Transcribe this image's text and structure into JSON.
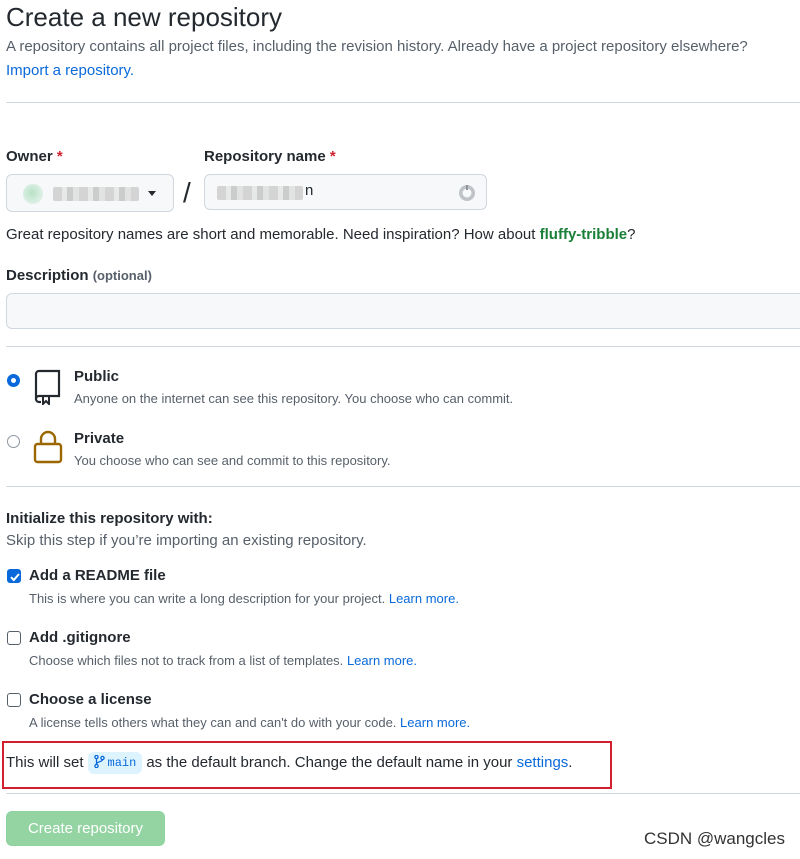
{
  "header": {
    "title": "Create a new repository",
    "subtitle": "A repository contains all project files, including the revision history. Already have a project repository elsewhere?",
    "import_link": "Import a repository."
  },
  "owner": {
    "label": "Owner",
    "required_mark": "*",
    "avatar_icon": "avatar-icon"
  },
  "repo": {
    "label": "Repository name",
    "required_mark": "*",
    "visible_suffix": "n",
    "status_icon": "loading-icon"
  },
  "separator": "/",
  "name_hint": {
    "text": "Great repository names are short and memorable. Need inspiration? How about",
    "suggestion": "fluffy-tribble",
    "suffix": "?"
  },
  "description": {
    "label": "Description",
    "optional": "(optional)",
    "value": ""
  },
  "visibility": {
    "selected": "public",
    "public": {
      "title": "Public",
      "desc": "Anyone on the internet can see this repository. You choose who can commit.",
      "icon": "repo-icon"
    },
    "private": {
      "title": "Private",
      "desc": "You choose who can see and commit to this repository.",
      "icon": "lock-icon"
    }
  },
  "init": {
    "heading": "Initialize this repository with:",
    "sub": "Skip this step if you’re importing an existing repository.",
    "options": [
      {
        "title": "Add a README file",
        "desc": "This is where you can write a long description for your project.",
        "link": "Learn more.",
        "checked": true
      },
      {
        "title": "Add .gitignore",
        "desc": "Choose which files not to track from a list of templates.",
        "link": "Learn more.",
        "checked": false
      },
      {
        "title": "Choose a license",
        "desc": "A license tells others what they can and can't do with your code.",
        "link": "Learn more.",
        "checked": false
      }
    ]
  },
  "branch_notice": {
    "before": "This will set",
    "branch": "main",
    "after": "as the default branch. Change the default name in your",
    "link": "settings",
    "end": "."
  },
  "submit": {
    "label": "Create repository",
    "disabled": true
  },
  "watermark": "CSDN @wangcles",
  "colors": {
    "accent": "#0969da",
    "success": "#1a7f37",
    "danger": "#cf222e",
    "button_disabled": "#94d3a2",
    "highlight_border": "#d01f2f"
  }
}
